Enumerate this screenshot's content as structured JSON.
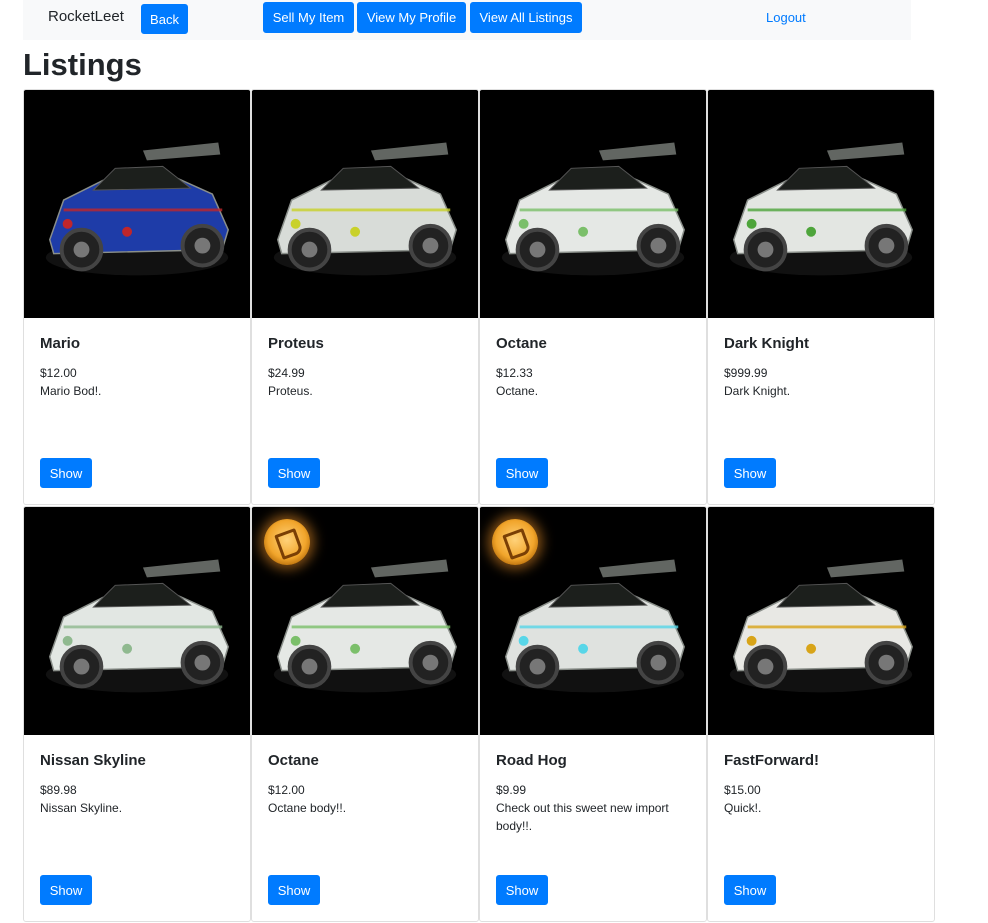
{
  "nav": {
    "brand": "RocketLeet",
    "back": "Back",
    "sell": "Sell My Item",
    "profile": "View My Profile",
    "all_listings": "View All Listings",
    "logout": "Logout"
  },
  "page": {
    "title": "Listings"
  },
  "listings": [
    {
      "name": "Mario",
      "price": "$12.00",
      "description": "Mario Bod!.",
      "show_label": "Show",
      "image": "car-mario",
      "badge": false,
      "body_color": "#1e3ca8",
      "accent": "#c0262b"
    },
    {
      "name": "Proteus",
      "price": "$24.99",
      "description": "Proteus.",
      "show_label": "Show",
      "image": "car-proteus",
      "badge": false,
      "body_color": "#d8dcd8",
      "accent": "#c9d12a"
    },
    {
      "name": "Octane",
      "price": "$12.33",
      "description": "Octane.",
      "show_label": "Show",
      "image": "car-octane",
      "badge": false,
      "body_color": "#e5e8e5",
      "accent": "#7bbf6a"
    },
    {
      "name": "Dark Knight",
      "price": "$999.99",
      "description": "Dark Knight.",
      "show_label": "Show",
      "image": "car-dark-knight",
      "badge": false,
      "body_color": "#e3e6e2",
      "accent": "#4ea53b"
    },
    {
      "name": "Nissan Skyline",
      "price": "$89.98",
      "description": "Nissan Skyline.",
      "show_label": "Show",
      "image": "car-nissan-skyline",
      "badge": false,
      "body_color": "#e2e7e3",
      "accent": "#8fb98f"
    },
    {
      "name": "Octane",
      "price": "$12.00",
      "description": "Octane body!!.",
      "show_label": "Show",
      "image": "car-octane",
      "badge": true,
      "body_color": "#e5e8e5",
      "accent": "#7bbf6a"
    },
    {
      "name": "Road Hog",
      "price": "$9.99",
      "description": "Check out this sweet new import body!!.",
      "show_label": "Show",
      "image": "car-road-hog",
      "badge": true,
      "body_color": "#dfe2df",
      "accent": "#58d6e8"
    },
    {
      "name": "FastForward!",
      "price": "$15.00",
      "description": "Quick!.",
      "show_label": "Show",
      "image": "car-fastforward",
      "badge": false,
      "body_color": "#e8e8e4",
      "accent": "#d8a418"
    }
  ]
}
